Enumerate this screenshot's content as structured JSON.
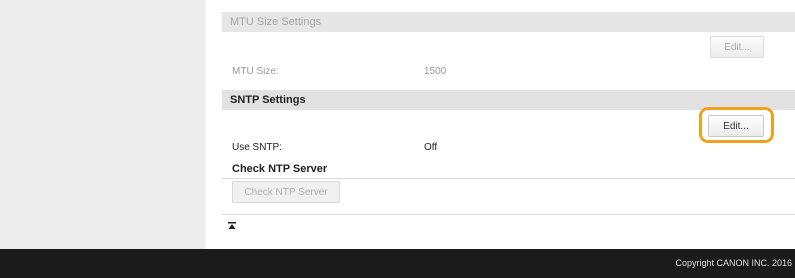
{
  "mtu_section": {
    "title": "MTU Size Settings",
    "edit_label": "Edit...",
    "mtu_size_label": "MTU Size:",
    "mtu_size_value": "1500"
  },
  "sntp_section": {
    "title": "SNTP Settings",
    "edit_label": "Edit...",
    "use_sntp_label": "Use SNTP:",
    "use_sntp_value": "Off",
    "check_ntp_heading": "Check NTP Server",
    "check_ntp_button": "Check NTP Server"
  },
  "back_to_top_icon": "arrow-to-top-icon",
  "footer": {
    "copyright": "Copyright CANON INC. 2016"
  },
  "colors": {
    "highlight": "#f0a21e",
    "footer_bg": "#1b1b1b"
  }
}
